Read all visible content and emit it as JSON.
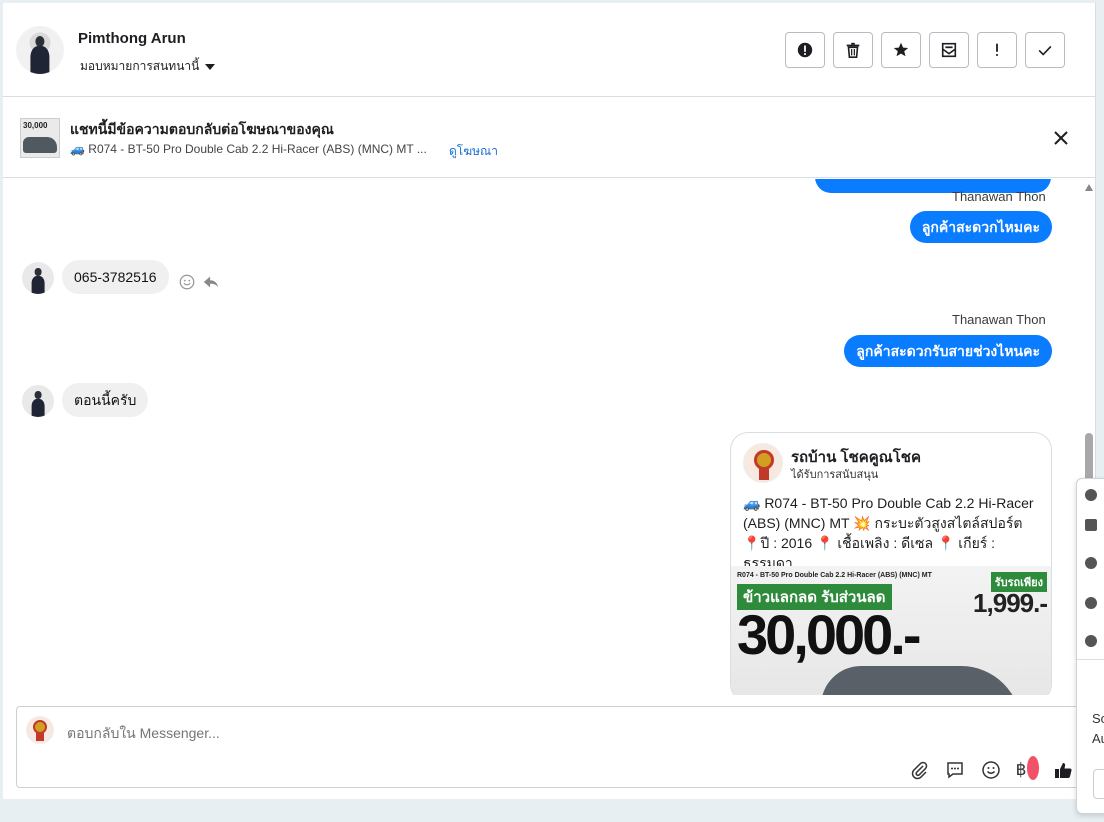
{
  "header": {
    "contact_name": "Pimthong Arun",
    "assign_label": "มอบหมายการสนทนานี้"
  },
  "banner": {
    "title": "แชทนี้มีข้อความตอบกลับต่อโฆษณาของคุณ",
    "ad_text": "🚙 R074 - BT-50 Pro Double Cab 2.2 Hi-Racer (ABS) (MNC) MT ...",
    "view_ad_link": "ดูโฆษณา",
    "thumb_text": "30,000"
  },
  "messages": [
    {
      "sender": "Thanawan Thon",
      "text": "ลูกค้าสะดวกไหมคะ",
      "direction": "out"
    },
    {
      "text": "065-3782516",
      "direction": "in"
    },
    {
      "sender": "Thanawan Thon",
      "text": "ลูกค้าสะดวกรับสายช่วงไหนคะ",
      "direction": "out"
    },
    {
      "text": "ตอนนี้ครับ",
      "direction": "in"
    }
  ],
  "ad_card": {
    "page_name": "รถบ้าน โชคคูณโชค",
    "sponsored": "ได้รับการสนับสนุน",
    "text": "🚙 R074 - BT-50 Pro Double Cab 2.2 Hi-Racer (ABS) (MNC) MT 💥 กระบะตัวสูงสไตล์สปอร์ต 📍ปี : 2016 📍 เชื้อเพลิง : ดีเซล 📍 เกียร์ : ธรรมดา...",
    "image": {
      "top_line": "R074 - BT-50 Pro Double Cab 2.2 Hi-Racer (ABS) (MNC) MT",
      "headline": "ข้าวแลกลด รับส่วนลด",
      "price": "30,000.-",
      "down_label": "รับรถเพียง",
      "down_price": "1,999.-"
    }
  },
  "composer": {
    "placeholder": "ตอบกลับใน Messenger..."
  },
  "popup": {
    "text_line1": "So",
    "text_line2": "Au"
  },
  "colors": {
    "accent": "#0a7cff",
    "incoming_bubble": "#f0f0f0",
    "notification_dot": "#f25268"
  },
  "icons": {
    "actions": [
      "exclamation-circle-icon",
      "trash-icon",
      "star-icon",
      "mail-icon",
      "exclamation-icon",
      "check-icon"
    ],
    "composer_tools": [
      "attachment-icon",
      "chat-bubble-icon",
      "emoji-icon",
      "baht-icon",
      "thumbs-up-icon"
    ]
  }
}
